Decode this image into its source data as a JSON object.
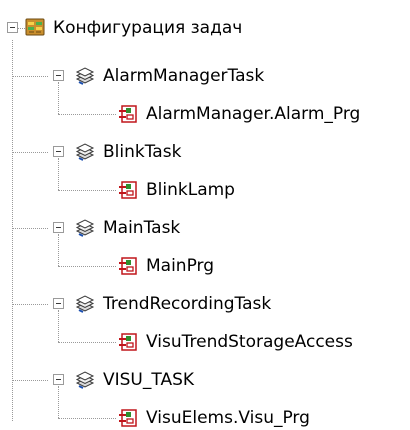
{
  "tree": {
    "root": {
      "label": "Конфигурация задач",
      "icon": "task-configuration-icon",
      "expanded": true,
      "tasks": [
        {
          "label": "AlarmManagerTask",
          "icon": "task-stack-icon",
          "expanded": true,
          "program": {
            "label": "AlarmManager.Alarm_Prg",
            "icon": "program-call-icon"
          }
        },
        {
          "label": "BlinkTask",
          "icon": "task-stack-icon",
          "expanded": true,
          "program": {
            "label": "BlinkLamp",
            "icon": "program-call-icon"
          }
        },
        {
          "label": "MainTask",
          "icon": "task-stack-icon",
          "expanded": true,
          "program": {
            "label": "MainPrg",
            "icon": "program-call-icon"
          }
        },
        {
          "label": "TrendRecordingTask",
          "icon": "task-stack-icon",
          "expanded": true,
          "program": {
            "label": "VisuTrendStorageAccess",
            "icon": "program-call-icon"
          }
        },
        {
          "label": "VISU_TASK",
          "icon": "task-stack-icon",
          "expanded": true,
          "program": {
            "label": "VisuElems.Visu_Prg",
            "icon": "program-call-icon"
          }
        }
      ]
    }
  },
  "colors": {
    "tree_line": "#9a9a9a",
    "program_icon_red": "#c0161c",
    "program_icon_green": "#2f8f2f"
  }
}
